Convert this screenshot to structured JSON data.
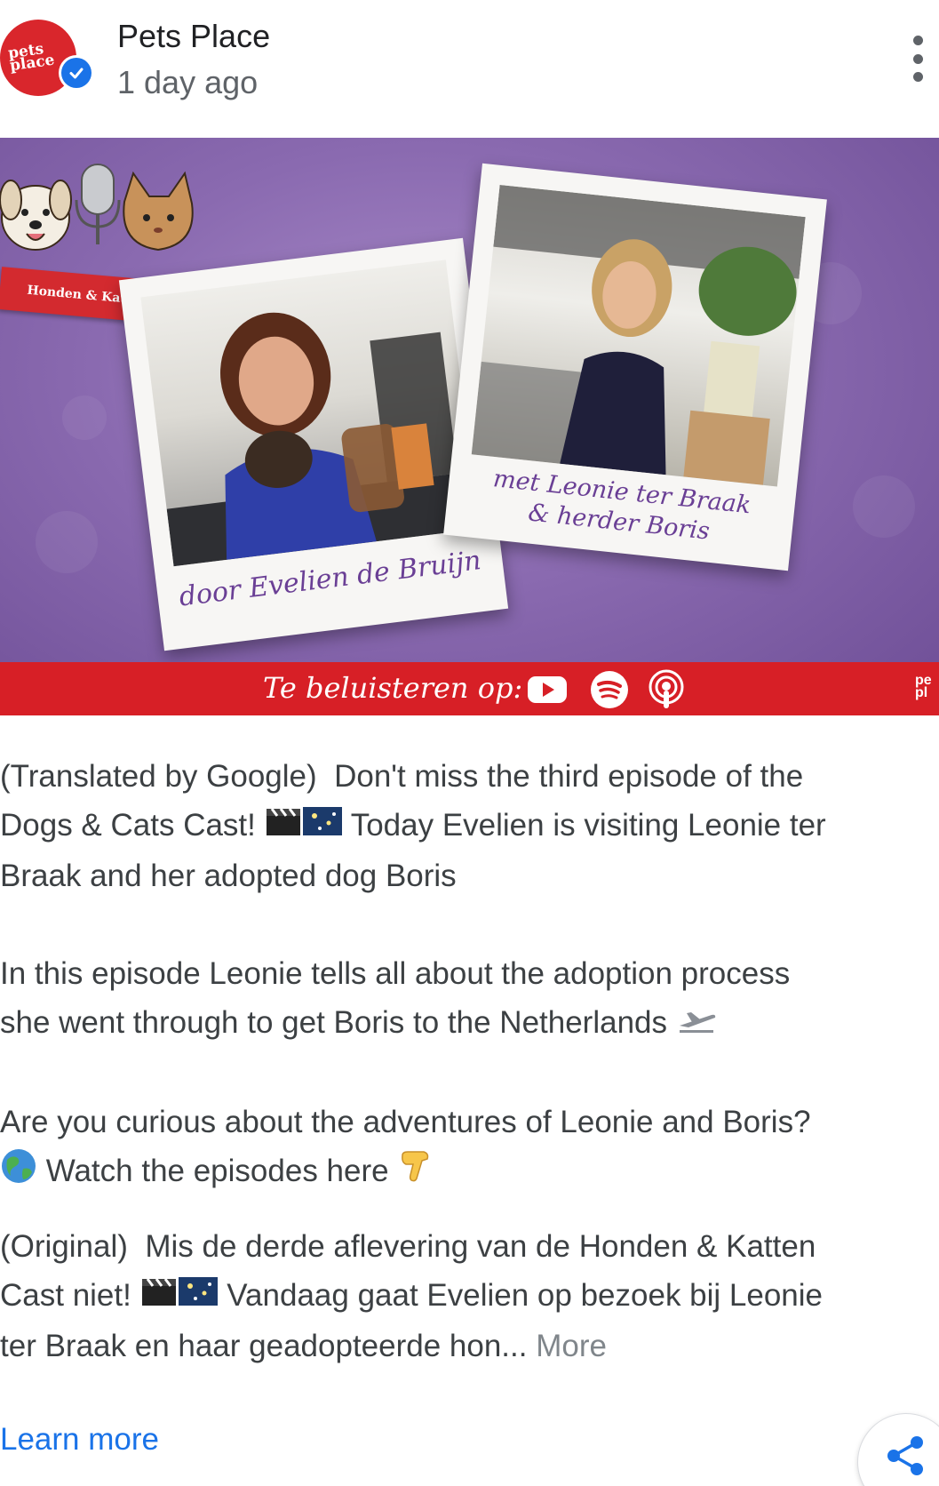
{
  "post": {
    "author": "Pets Place",
    "time_ago": "1 day ago",
    "avatar_text_line1": "pets",
    "avatar_text_line2": "place"
  },
  "banner": {
    "ribbon_text": "Honden & Katten Cast",
    "left_caption": "door Evelien de Bruijn",
    "right_caption_line1": "met Leonie ter Braak",
    "right_caption_line2": "& herder Boris",
    "listen_text": "Te beluisteren op:",
    "corner_logo_line1": "pe",
    "corner_logo_line2": "pl",
    "icons": [
      "youtube-icon",
      "spotify-icon",
      "podcast-icon"
    ]
  },
  "text": {
    "translated_label": "(Translated by Google)",
    "translated_p1a": "  Don't miss the third episode of the",
    "translated_p1b": "Dogs & Cats Cast! ",
    "translated_p1c": " Today Evelien is visiting Leonie ter",
    "translated_p1d": "Braak and her adopted dog Boris",
    "translated_p2a": "In this episode Leonie tells all about the adoption process",
    "translated_p2b": "she went through to get Boris to the Netherlands ",
    "translated_p3a": "Are you curious about the adventures of Leonie and Boris?",
    "translated_p3b": " Watch the episodes here ",
    "original_label": "(Original)",
    "original_p1a": "  Mis de derde aflevering van de Honden & Katten",
    "original_p1b": "Cast niet! ",
    "original_p1c": " Vandaag gaat Evelien op bezoek bij Leonie",
    "original_p1d": "ter Braak en haar geadopteerde hon... ",
    "more_label": "More"
  },
  "footer": {
    "learn_more": "Learn more"
  },
  "colors": {
    "brand_red": "#d71f26",
    "link_blue": "#1a73e8",
    "banner_purple": "#8a6ab0"
  }
}
